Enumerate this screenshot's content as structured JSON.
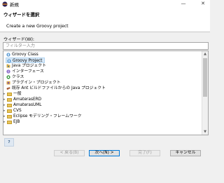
{
  "window": {
    "title": "新規"
  },
  "banner": {
    "title": "ウィザードを選択",
    "description": "Create a new Groovy project"
  },
  "wizards_label": "ウィザード(W):",
  "filter": {
    "placeholder": "フィルター入力",
    "value": ""
  },
  "tree": {
    "items": [
      {
        "label": "Groovy Class",
        "icon": "groovy-icon",
        "selected": false
      },
      {
        "label": "Groovy Project",
        "icon": "groovy-icon",
        "selected": true
      },
      {
        "label": "Java プロジェクト",
        "icon": "java-project-icon",
        "selected": false
      },
      {
        "label": "インターフェース",
        "icon": "interface-icon",
        "selected": false
      },
      {
        "label": "クラス",
        "icon": "class-icon",
        "selected": false
      },
      {
        "label": "プラグイン・プロジェクト",
        "icon": "plugin-icon",
        "selected": false
      },
      {
        "label": "既存 Ant ビルドファイルからの Java プロジェクト",
        "icon": "ant-icon",
        "selected": false
      },
      {
        "label": "一般",
        "icon": "folder-icon",
        "expander": "chevron-right-icon"
      },
      {
        "label": "AmaterasERD",
        "icon": "folder-icon",
        "expander": "chevron-right-icon"
      },
      {
        "label": "AmaterasUML",
        "icon": "folder-icon",
        "expander": "chevron-right-icon"
      },
      {
        "label": "CVS",
        "icon": "folder-icon",
        "expander": "chevron-right-icon"
      },
      {
        "label": "Eclipse モデリング・フレームワーク",
        "icon": "folder-icon",
        "expander": "chevron-right-icon"
      },
      {
        "label": "EJB",
        "icon": "folder-icon",
        "expander": "chevron-right-icon"
      }
    ]
  },
  "buttons": {
    "back": "< 戻る(B)",
    "next": "次へ(N) >",
    "finish": "完了(F)",
    "cancel": "キャンセル"
  },
  "colors": {
    "selection": "#d8e9f8",
    "primary_border": "#0078d7",
    "folder": "#e8c55a"
  }
}
